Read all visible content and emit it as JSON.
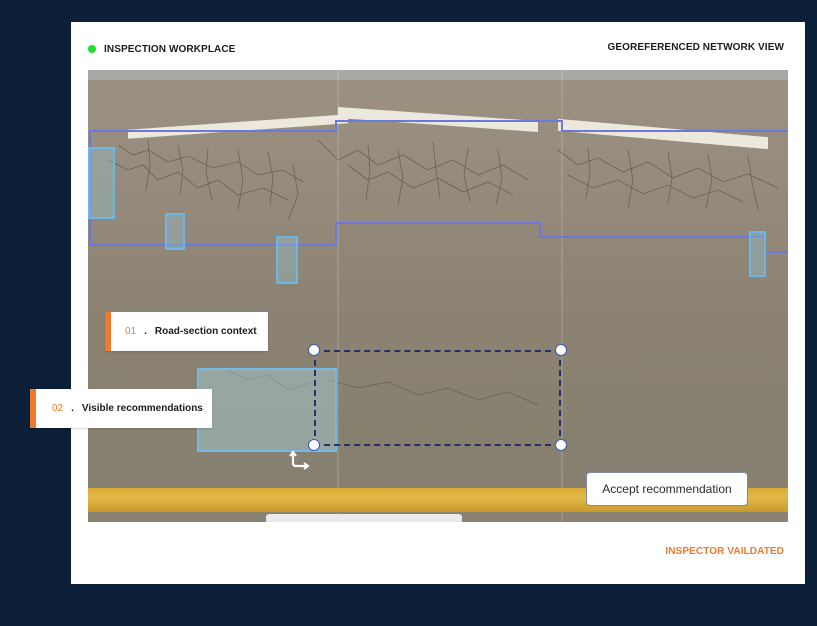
{
  "header": {
    "left_title": "INSPECTION WORKPLACE",
    "right_title": "GEOREFERENCED NETWORK VIEW",
    "status_dot_color": "#1ddc2e"
  },
  "footer": {
    "status": "INSPECTOR VAILDATED",
    "status_color": "#ef7a2e"
  },
  "callouts": [
    {
      "number": "01",
      "separator": ".",
      "label": "Road-section context"
    },
    {
      "number": "02",
      "separator": ".",
      "label": "Visible recommendations"
    }
  ],
  "actions": {
    "accept_label": "Accept recommendation"
  },
  "colors": {
    "accent": "#ef7a2e",
    "network_outline": "#6b78e0",
    "annotation_box": "#6ab6e8",
    "selection": "#24306a",
    "background": "#0b1f38"
  }
}
